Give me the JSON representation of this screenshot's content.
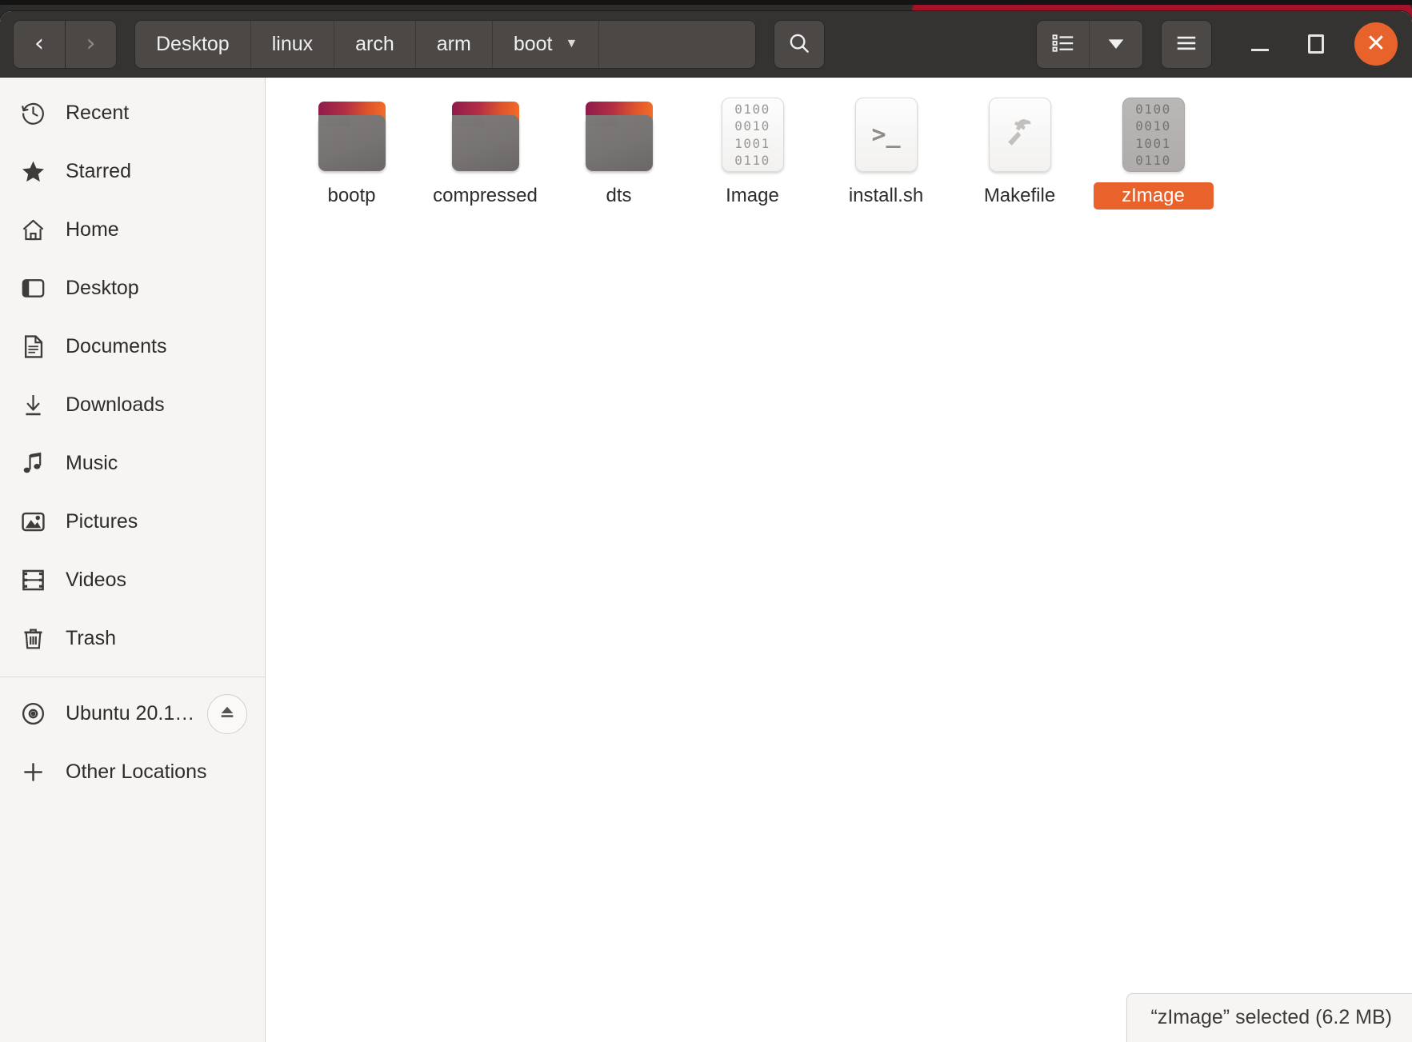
{
  "window": {
    "title": "boot",
    "controls": {
      "minimize_label": "Minimize",
      "maximize_label": "Maximize",
      "close_label": "Close"
    }
  },
  "header": {
    "nav": {
      "back_glyph": "‹",
      "forward_glyph": "›",
      "back_label": "Back",
      "forward_label": "Forward"
    },
    "breadcrumbs": [
      {
        "label": "Desktop",
        "has_caret": false
      },
      {
        "label": "linux",
        "has_caret": false
      },
      {
        "label": "arch",
        "has_caret": false
      },
      {
        "label": "arm",
        "has_caret": false
      },
      {
        "label": "boot",
        "has_caret": true,
        "caret": "▼"
      }
    ],
    "search_label": "Search",
    "view_list_label": "List view",
    "view_dropdown_label": "View options",
    "view_dropdown_caret": "▼",
    "menu_label": "Main menu"
  },
  "sidebar": {
    "items": [
      {
        "label": "Recent",
        "icon": "clock-icon"
      },
      {
        "label": "Starred",
        "icon": "star-icon"
      },
      {
        "label": "Home",
        "icon": "home-icon"
      },
      {
        "label": "Desktop",
        "icon": "desktop-icon"
      },
      {
        "label": "Documents",
        "icon": "documents-icon"
      },
      {
        "label": "Downloads",
        "icon": "downloads-icon"
      },
      {
        "label": "Music",
        "icon": "music-icon"
      },
      {
        "label": "Pictures",
        "icon": "pictures-icon"
      },
      {
        "label": "Videos",
        "icon": "videos-icon"
      },
      {
        "label": "Trash",
        "icon": "trash-icon"
      }
    ],
    "devices": [
      {
        "label": "Ubuntu 20.1…",
        "icon": "disc-icon",
        "eject_label": "Eject"
      }
    ],
    "other_locations": {
      "label": "Other Locations",
      "icon": "plus-icon"
    }
  },
  "files": [
    {
      "name": "bootp",
      "type": "folder",
      "selected": false
    },
    {
      "name": "compressed",
      "type": "folder",
      "selected": false
    },
    {
      "name": "dts",
      "type": "folder",
      "selected": false
    },
    {
      "name": "Image",
      "type": "binary",
      "selected": false
    },
    {
      "name": "install.sh",
      "type": "script",
      "selected": false
    },
    {
      "name": "Makefile",
      "type": "makefile",
      "selected": false
    },
    {
      "name": "zImage",
      "type": "binary",
      "selected": true
    }
  ],
  "binary_icon_rows": [
    "0100",
    "0010",
    "1001",
    "0110"
  ],
  "script_icon_glyph": ">_",
  "status": {
    "text": "“zImage” selected  (6.2 MB)"
  },
  "colors": {
    "accent": "#e9622c",
    "header_bg": "#353331",
    "sidebar_bg": "#f6f5f4",
    "content_bg": "#ffffff",
    "selection": "#e9622c",
    "backdrop_red": "#a8132b"
  }
}
